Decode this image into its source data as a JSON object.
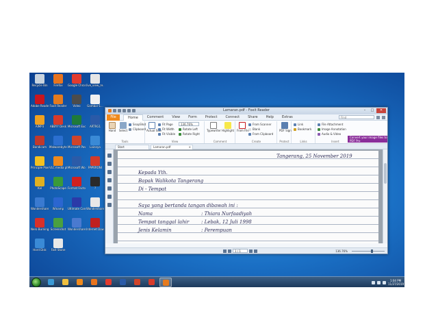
{
  "desktop": {
    "icons": [
      {
        "label": "Recycle Bin",
        "color": "#c9d3de"
      },
      {
        "label": "Firefox",
        "color": "#e8741f"
      },
      {
        "label": "Google Chrome",
        "color": "#e33b2e"
      },
      {
        "label": "live_view_re...",
        "color": "#e6e6e6"
      },
      {
        "label": "Adobe Reader XI",
        "color": "#c8161e"
      },
      {
        "label": "Foxit Reader",
        "color": "#e57a1e"
      },
      {
        "label": "Video",
        "color": "#4c4c4c"
      },
      {
        "label": "Gambar-1...",
        "color": "#f1f1f1"
      },
      {
        "label": "AIMP3",
        "color": "#f0a020"
      },
      {
        "label": "ABBYY Desk",
        "color": "#d83a2a"
      },
      {
        "label": "Microsoft Excel 2010",
        "color": "#1f7a3a"
      },
      {
        "label": "ARTRG1",
        "color": "#2a5aa8"
      },
      {
        "label": "Bandicam",
        "color": "#c0392b"
      },
      {
        "label": "Malwarebytes",
        "color": "#2b6fd0"
      },
      {
        "label": "Microsoft PowerPoint",
        "color": "#d0442a"
      },
      {
        "label": "Lainnya",
        "color": "#3a8ad6"
      },
      {
        "label": "Principle Pixel Files",
        "color": "#f4c020"
      },
      {
        "label": "VLC media player",
        "color": "#f08a1c"
      },
      {
        "label": "Microsoft Word 2010",
        "color": "#2b5ba8"
      },
      {
        "label": "PAPERONI",
        "color": "#d33a2a"
      },
      {
        "label": "Kal",
        "color": "#e0b020"
      },
      {
        "label": "PhotoScape",
        "color": "#3a9a3a"
      },
      {
        "label": "Format Factory",
        "color": "#d02020"
      },
      {
        "label": "?",
        "color": "#2a2a2a"
      },
      {
        "label": "Wondershare Filmora",
        "color": "#3a7ad0"
      },
      {
        "label": "Winamp",
        "color": "#2b66d0"
      },
      {
        "label": "Ultimate Camera",
        "color": "#2b3aa8"
      },
      {
        "label": "Wondershare Scan",
        "color": "#e8e8e8"
      },
      {
        "label": "Nero Burning",
        "color": "#d8302a"
      },
      {
        "label": "Screenshot",
        "color": "#4aa040"
      },
      {
        "label": "Wondershare Tools",
        "color": "#4a7ad0"
      },
      {
        "label": "Internet Download",
        "color": "#c02020"
      },
      {
        "label": "Hard Disk",
        "color": "#3a8ad6"
      },
      {
        "label": "Fast Stone",
        "color": "#e8e8e8"
      }
    ]
  },
  "taskbar": {
    "apps": [
      {
        "name": "ie",
        "color": "#3a9ad6"
      },
      {
        "name": "explorer",
        "color": "#f0c040"
      },
      {
        "name": "media-player",
        "color": "#f08a1c"
      },
      {
        "name": "firefox",
        "color": "#e8741f"
      },
      {
        "name": "chrome",
        "color": "#e33b2e"
      },
      {
        "name": "word",
        "color": "#2b5ba8"
      },
      {
        "name": "powerpoint",
        "color": "#d0442a"
      },
      {
        "name": "paint",
        "color": "#d83a2a"
      },
      {
        "name": "foxit",
        "color": "#e57a1e"
      }
    ],
    "clock_time": "1:04 PM",
    "clock_date": "11/27/2019"
  },
  "window": {
    "title": "Lamaran.pdf - Foxit Reader",
    "menu": {
      "file": "File",
      "tabs": [
        "Home",
        "Comment",
        "View",
        "Form",
        "Protect",
        "Connect",
        "Share",
        "Help",
        "Extras"
      ],
      "find_placeholder": "Find"
    },
    "ribbon": {
      "hand": "Hand",
      "select": "Select",
      "snapshot": "SnapShot",
      "clipboard": "Clipboard",
      "actual_size": "Actual Size",
      "fit_page": "Fit Page",
      "fit_width": "Fit Width",
      "fit_visible": "Fit Visible",
      "zoom_value": "136.76%",
      "rotate_left": "Rotate Left",
      "rotate_right": "Rotate Right",
      "typewriter": "Typewriter",
      "highlight": "Highlight",
      "from_file": "From File",
      "from_scanner": "From Scanner",
      "blank": "Blank",
      "from_clipboard": "From Clipboard",
      "pdf_sign": "PDF Sign",
      "link": "Link",
      "bookmark": "Bookmark",
      "file_attachment": "File Attachment",
      "image_annotation": "Image Annotation",
      "audio_video": "Audio & Video",
      "groups": [
        "Tools",
        "View",
        "Comment",
        "Create",
        "Protect",
        "Links",
        "Insert"
      ],
      "convert_banner": "Convert your image files to PDF Pro"
    },
    "tabs": [
      "Start",
      "Lamaran.pdf"
    ],
    "document_lines": [
      "Tangerang, 25 November 2019",
      "Kepada Yth.",
      "Bapak Walikota Tangerang",
      "Di - Tempat",
      "Saya yang bertanda tangan dibawah ini :",
      "Nama",
      ": Thiara Nurfaadiyah",
      "Tempat tanggal lahir",
      ": Lebak, 12 Juli 1998",
      "Jenis Kelamin",
      ": Perempuan"
    ],
    "status": {
      "page": "1 / 1",
      "zoom": "136.76%",
      "zoom_fraction": 0.62
    }
  }
}
